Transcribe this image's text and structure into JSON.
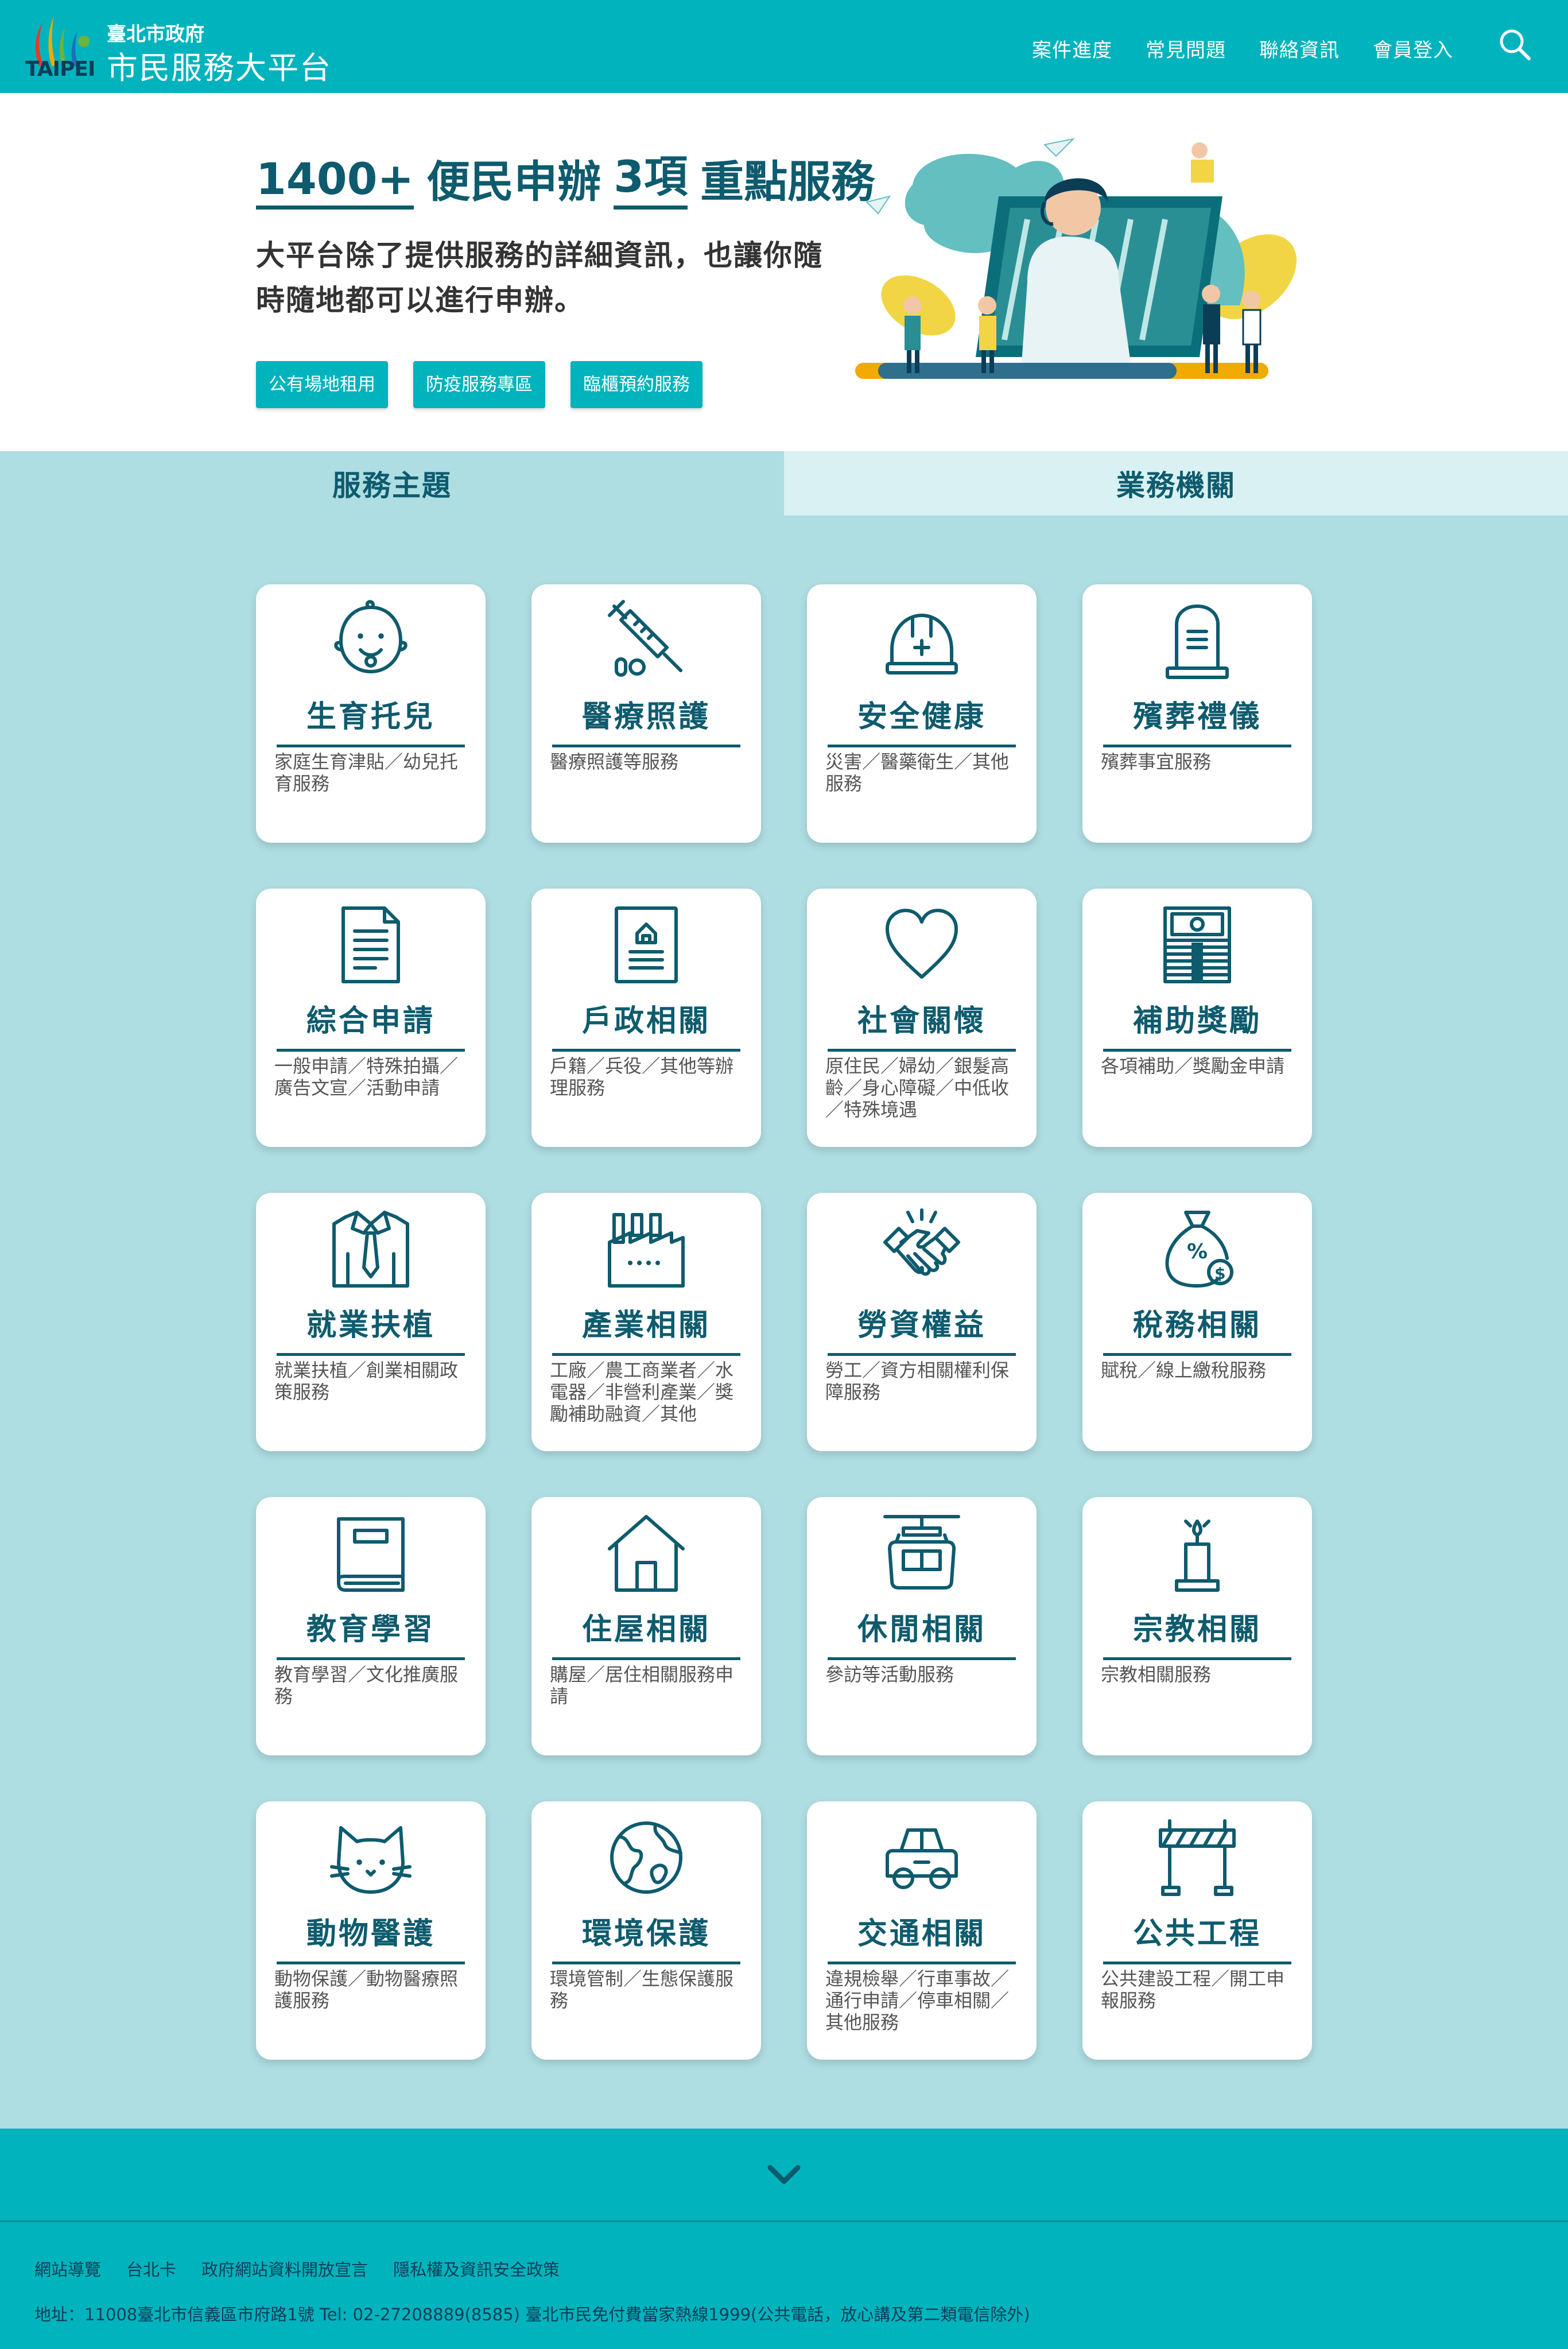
{
  "header": {
    "logo_text": "TAIPEI",
    "brand_sub": "臺北市政府",
    "brand_title": "市民服務大平台",
    "nav": [
      "案件進度",
      "常見問題",
      "聯絡資訊",
      "會員登入"
    ]
  },
  "hero": {
    "headline": {
      "num1": "1400+",
      "text1": "便民申辦",
      "num2": "3項",
      "text2": "重點服務"
    },
    "intro": "大平台除了提供服務的詳細資訊，也讓你隨時隨地都可以進行申辦。",
    "quick_links": [
      "公有場地租用",
      "防疫服務專區",
      "臨櫃預約服務"
    ]
  },
  "tabs": [
    "服務主題",
    "業務機關"
  ],
  "cards": [
    {
      "title": "生育托兒",
      "desc": "家庭生育津貼／幼兒托育服務",
      "icon": "baby-icon"
    },
    {
      "title": "醫療照護",
      "desc": "醫療照護等服務",
      "icon": "syringe-icon"
    },
    {
      "title": "安全健康",
      "desc": "災害／醫藥衛生／其他服務",
      "icon": "helmet-icon"
    },
    {
      "title": "殯葬禮儀",
      "desc": "殯葬事宜服務",
      "icon": "tombstone-icon"
    },
    {
      "title": "綜合申請",
      "desc": "一般申請／特殊拍攝／廣告文宣／活動申請",
      "icon": "document-icon"
    },
    {
      "title": "戶政相關",
      "desc": "戶籍／兵役／其他等辦理服務",
      "icon": "household-icon"
    },
    {
      "title": "社會關懷",
      "desc": "原住民／婦幼／銀髮高齡／身心障礙／中低收／特殊境遇",
      "icon": "heart-icon"
    },
    {
      "title": "補助獎勵",
      "desc": "各項補助／獎勵金申請",
      "icon": "money-stack-icon"
    },
    {
      "title": "就業扶植",
      "desc": "就業扶植／創業相關政策服務",
      "icon": "shirt-tie-icon"
    },
    {
      "title": "產業相關",
      "desc": "工廠／農工商業者／水電器／非營利產業／獎勵補助融資／其他",
      "icon": "factory-icon"
    },
    {
      "title": "勞資權益",
      "desc": "勞工／資方相關權利保障服務",
      "icon": "handshake-icon"
    },
    {
      "title": "稅務相關",
      "desc": "賦稅／線上繳稅服務",
      "icon": "tax-bag-icon"
    },
    {
      "title": "教育學習",
      "desc": "教育學習／文化推廣服務",
      "icon": "book-icon"
    },
    {
      "title": "住屋相關",
      "desc": "購屋／居住相關服務申請",
      "icon": "house-icon"
    },
    {
      "title": "休閒相關",
      "desc": "參訪等活動服務",
      "icon": "cable-car-icon"
    },
    {
      "title": "宗教相關",
      "desc": "宗教相關服務",
      "icon": "candle-icon"
    },
    {
      "title": "動物醫護",
      "desc": "動物保護／動物醫療照護服務",
      "icon": "cat-icon"
    },
    {
      "title": "環境保護",
      "desc": "環境管制／生態保護服務",
      "icon": "globe-icon"
    },
    {
      "title": "交通相關",
      "desc": "違規檢舉／行車事故／通行申請／停車相關／其他服務",
      "icon": "car-icon"
    },
    {
      "title": "公共工程",
      "desc": "公共建設工程／開工申報服務",
      "icon": "barrier-icon"
    }
  ],
  "footer": {
    "links": [
      "網站導覽",
      "台北卡",
      "政府網站資料開放宣言",
      "隱私權及資訊安全政策"
    ],
    "address": "地址：11008臺北市信義區市府路1號 Tel: 02-27208889(8585) 臺北市民免付費當家熱線1999(公共電話，放心講及第二類電信除外)"
  },
  "colors": {
    "brand": "#00b3bd",
    "dark_teal": "#0e5b6e",
    "panel": "#aedde2",
    "tab_inactive": "#d9f1f3"
  }
}
